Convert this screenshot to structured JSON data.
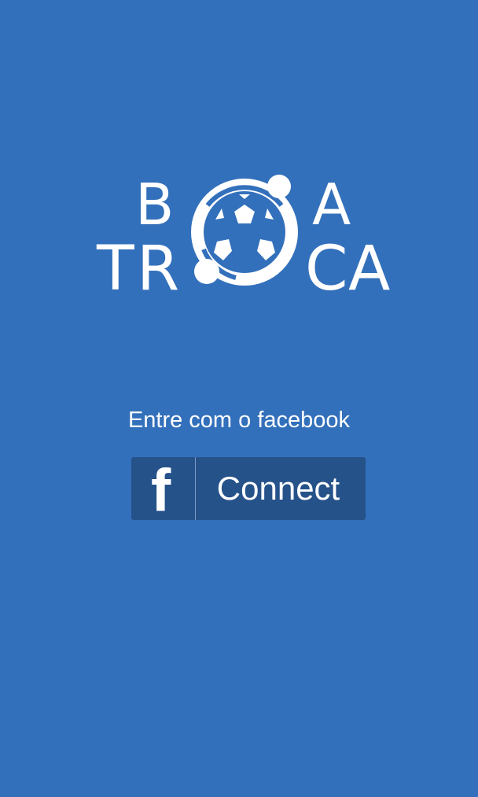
{
  "brand": {
    "logo_top": [
      "B",
      "A"
    ],
    "logo_bottom": [
      "T",
      "R",
      "C",
      "A"
    ],
    "logo_word_1": "BOA",
    "logo_word_2": "TROCA"
  },
  "login": {
    "prompt": "Entre com o facebook",
    "button_label": "Connect",
    "button_icon": "facebook-f-icon",
    "button_icon_glyph": "f"
  },
  "colors": {
    "background": "#3370bb",
    "button": "#26528a",
    "text": "#ffffff"
  }
}
